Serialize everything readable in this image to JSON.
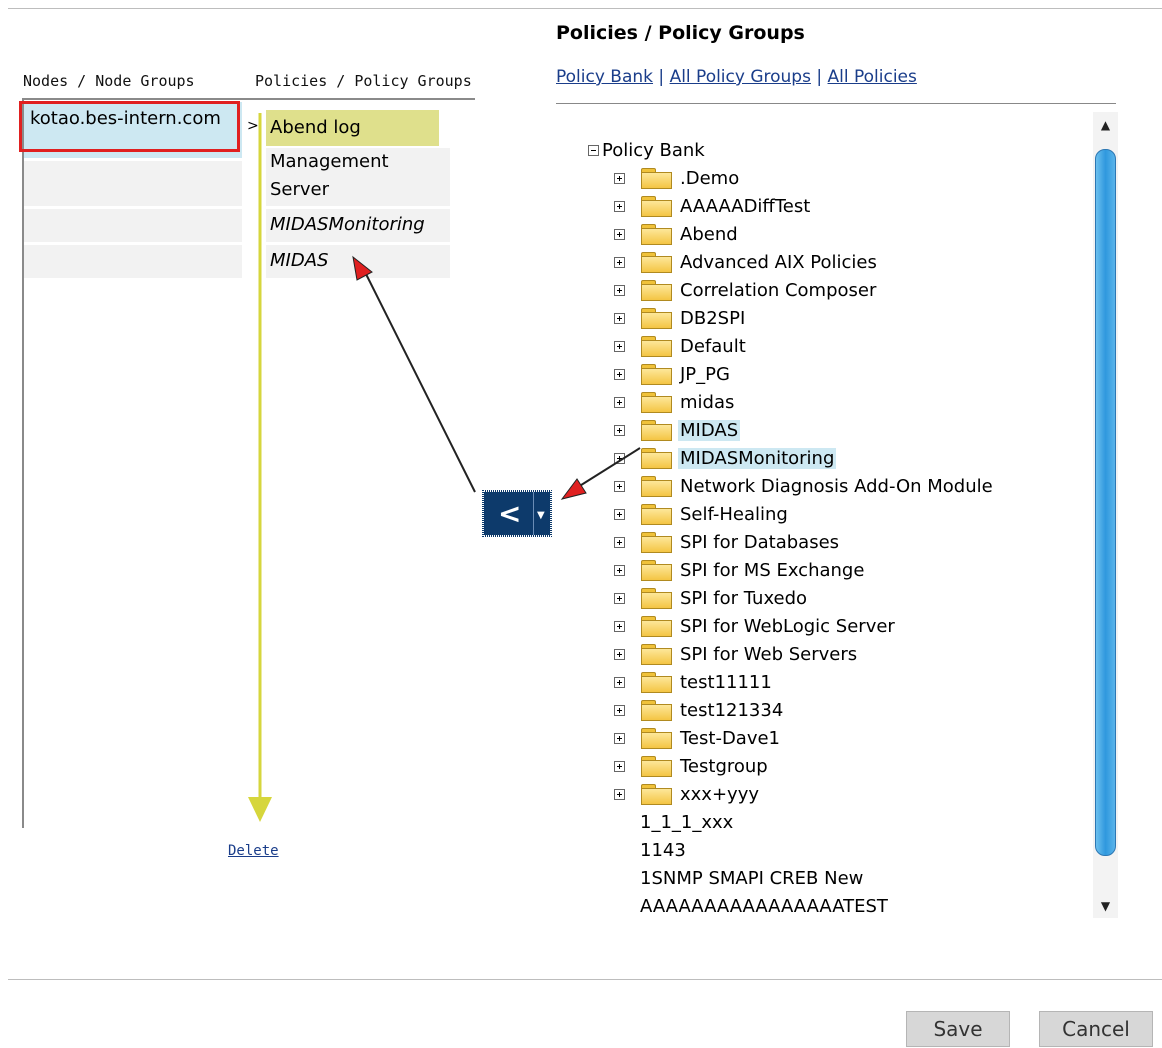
{
  "left_panel": {
    "col_nodes": "Nodes / Node Groups",
    "col_policies": "Policies / Policy Groups",
    "node": "kotao.bes-intern.com",
    "arrow": ">",
    "policies": [
      "Abend log",
      "Management Server",
      "MIDASMonitoring",
      "MIDAS"
    ],
    "delete_label": "Delete"
  },
  "right_panel": {
    "title": "Policies / Policy Groups",
    "links": [
      "Policy Bank",
      "All Policy Groups",
      "All Policies"
    ],
    "tree_root": "Policy Bank",
    "folders": [
      ".Demo",
      "AAAAADiffTest",
      "Abend",
      "Advanced AIX Policies",
      "Correlation Composer",
      "DB2SPI",
      "Default",
      "JP_PG",
      "midas",
      "MIDAS",
      "MIDASMonitoring",
      "Network Diagnosis Add-On Module",
      "Self-Healing",
      "SPI for Databases",
      "SPI for MS Exchange",
      "SPI for Tuxedo",
      "SPI for WebLogic Server",
      "SPI for Web Servers",
      "test11111",
      "test121334",
      "Test-Dave1",
      "Testgroup",
      "xxx+yyy"
    ],
    "selected_folders": [
      "MIDAS",
      "MIDASMonitoring"
    ],
    "policies": [
      "1_1_1_xxx",
      "1143",
      "1SNMP SMAPI CREB New",
      "AAAAAAAAAAAAAAAATEST"
    ]
  },
  "move_button": {
    "label": "<"
  },
  "buttons": {
    "save": "Save",
    "cancel": "Cancel"
  },
  "colors": {
    "selection": "#cde8f2",
    "highlight": "#dfe08c",
    "annotation_red": "#e02020",
    "button_navy": "#0d3a6b",
    "link": "#1a3d8a"
  }
}
